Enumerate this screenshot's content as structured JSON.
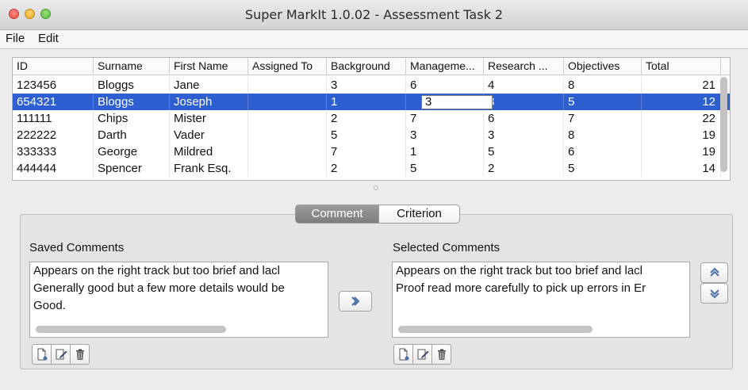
{
  "window": {
    "title": "Super MarkIt 1.0.02 - Assessment Task 2"
  },
  "menu": {
    "file": "File",
    "edit": "Edit"
  },
  "table": {
    "columns": [
      "ID",
      "Surname",
      "First Name",
      "Assigned To",
      "Background",
      "Manageme...",
      "Research ...",
      "Objectives",
      "Total"
    ],
    "rows": [
      [
        "123456",
        "Bloggs",
        "Jane",
        "",
        "3",
        "6",
        "4",
        "8",
        "21"
      ],
      [
        "654321",
        "Bloggs",
        "Joseph",
        "",
        "1",
        "3",
        "3",
        "5",
        "12"
      ],
      [
        "111111",
        "Chips",
        "Mister",
        "",
        "2",
        "7",
        "6",
        "7",
        "22"
      ],
      [
        "222222",
        "Darth",
        "Vader",
        "",
        "5",
        "3",
        "3",
        "8",
        "19"
      ],
      [
        "333333",
        "George",
        "Mildred",
        "",
        "7",
        "1",
        "5",
        "6",
        "19"
      ],
      [
        "444444",
        "Spencer",
        "Frank Esq.",
        "",
        "2",
        "5",
        "2",
        "5",
        "14"
      ]
    ],
    "selected_row": 1
  },
  "tabs": {
    "comment": "Comment",
    "criterion": "Criterion"
  },
  "saved": {
    "label": "Saved Comments",
    "items": [
      "Appears on the right track but too brief and lacl",
      "Generally good but a few more details would be",
      "Good."
    ]
  },
  "selected": {
    "label": "Selected Comments",
    "items": [
      "Appears on the right track but too brief and lacl",
      "Proof read more carefully to pick up errors in Er"
    ]
  },
  "colors": {
    "selection": "#2d5fd0",
    "accent_icon": "#4a6fa8"
  }
}
